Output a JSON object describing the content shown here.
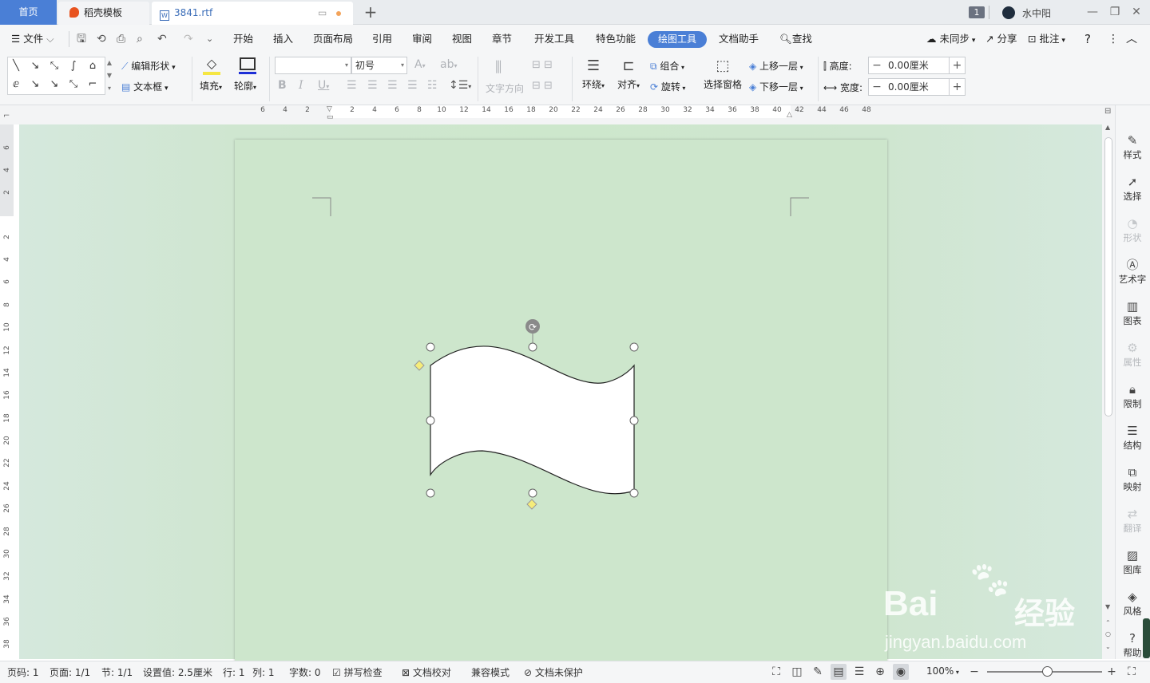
{
  "titlebar": {
    "tab_home": "首页",
    "tab_template": "稻壳模板",
    "tab_document": "3841.rtf",
    "new_tab": "+",
    "window_count": "1",
    "user_name": "水中阳"
  },
  "menubar": {
    "file": "文件",
    "items": [
      "开始",
      "插入",
      "页面布局",
      "引用",
      "审阅",
      "视图",
      "章节",
      "开发工具",
      "特色功能",
      "绘图工具",
      "文档助手"
    ],
    "search": "查找",
    "sync": "未同步",
    "share": "分享",
    "comment": "批注"
  },
  "toolbar": {
    "edit_shape": "编辑形状",
    "text_box": "文本框",
    "fill": "填充",
    "outline": "轮廓",
    "font_size": "初号",
    "text_direction": "文字方向",
    "wrap": "环绕",
    "align": "对齐",
    "group": "组合",
    "rotate": "旋转",
    "selection_pane": "选择窗格",
    "bring_forward": "上移一层",
    "send_backward": "下移一层",
    "height_label": "高度:",
    "height_value": "0.00厘米",
    "width_label": "宽度:",
    "width_value": "0.00厘米",
    "fill_color": "#f5e642",
    "outline_color": "#1d2fd6"
  },
  "ruler": {
    "horizontal": [
      "6",
      "4",
      "2",
      "2",
      "4",
      "6",
      "8",
      "10",
      "12",
      "14",
      "16",
      "18",
      "20",
      "22",
      "24",
      "26",
      "28",
      "30",
      "32",
      "34",
      "36",
      "38",
      "40",
      "42",
      "44",
      "46",
      "48"
    ],
    "vertical": [
      "6",
      "4",
      "2",
      "2",
      "4",
      "6",
      "8",
      "10",
      "12",
      "14",
      "16",
      "18",
      "20",
      "22",
      "24",
      "26",
      "28",
      "30",
      "32",
      "34",
      "36",
      "38"
    ]
  },
  "right_panel": [
    {
      "label": "样式",
      "icon": "pen-icon",
      "enabled": true
    },
    {
      "label": "选择",
      "icon": "cursor-icon",
      "enabled": true
    },
    {
      "label": "形状",
      "icon": "shape-icon",
      "enabled": false
    },
    {
      "label": "艺术字",
      "icon": "art-text-icon",
      "enabled": true
    },
    {
      "label": "图表",
      "icon": "chart-icon",
      "enabled": true
    },
    {
      "label": "属性",
      "icon": "properties-icon",
      "enabled": false
    },
    {
      "label": "限制",
      "icon": "lock-icon",
      "enabled": true
    },
    {
      "label": "结构",
      "icon": "structure-icon",
      "enabled": true
    },
    {
      "label": "映射",
      "icon": "mapping-icon",
      "enabled": true
    },
    {
      "label": "翻译",
      "icon": "translate-icon",
      "enabled": false
    },
    {
      "label": "图库",
      "icon": "gallery-icon",
      "enabled": true
    },
    {
      "label": "风格",
      "icon": "style-icon",
      "enabled": true
    },
    {
      "label": "帮助",
      "icon": "help-icon",
      "enabled": true
    }
  ],
  "statusbar": {
    "page_num": "页码: 1",
    "pages": "页面: 1/1",
    "section": "节: 1/1",
    "setting": "设置值: 2.5厘米",
    "row": "行: 1",
    "col": "列: 1",
    "words": "字数: 0",
    "spellcheck": "拼写检查",
    "proofread": "文档校对",
    "compat": "兼容模式",
    "protect": "文档未保护",
    "zoom": "100%",
    "zoom_level": 1.0
  },
  "watermark": {
    "brand": "Bai",
    "brand_cn": "经验",
    "url": "jingyan.baidu.com"
  }
}
